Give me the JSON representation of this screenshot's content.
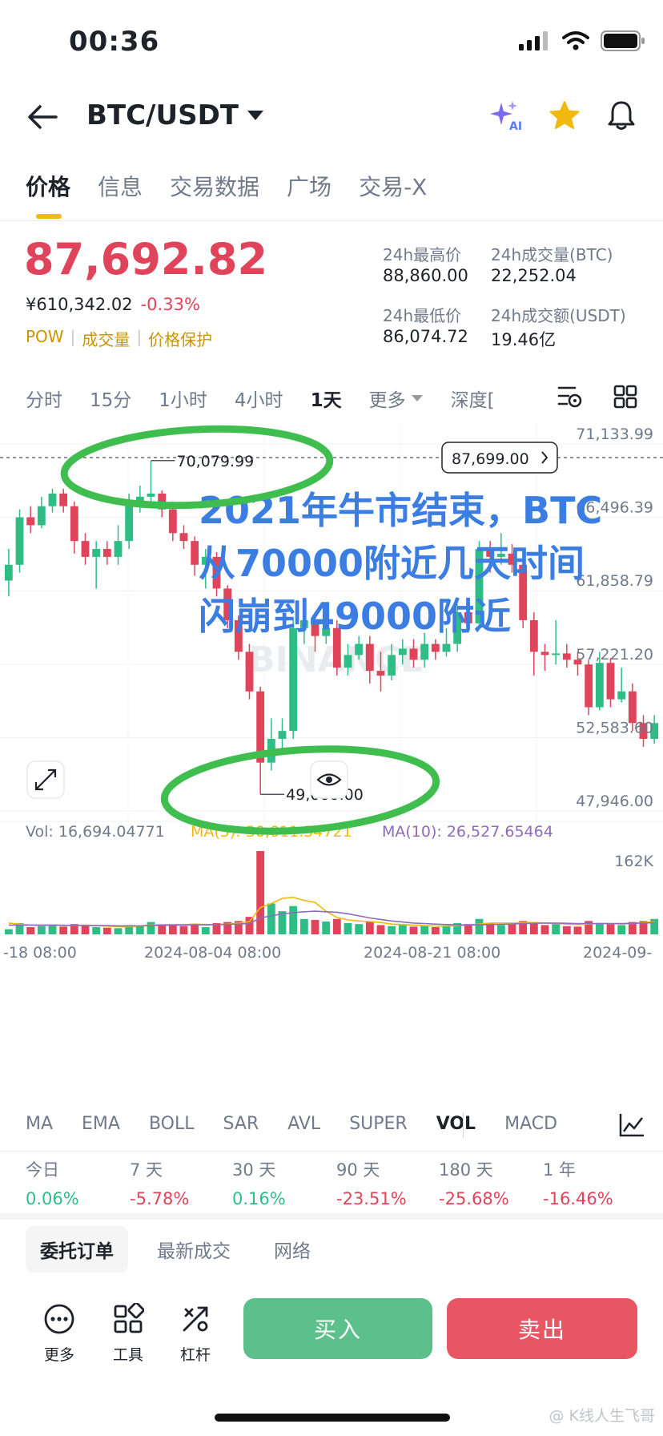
{
  "status": {
    "time": "00:36"
  },
  "header": {
    "pair": "BTC/USDT"
  },
  "tabs": [
    "价格",
    "信息",
    "交易数据",
    "广场",
    "交易-X"
  ],
  "price": {
    "last": "87,692.82",
    "cny": "¥610,342.02",
    "change": "-0.33%",
    "tags": [
      "POW",
      "成交量",
      "价格保护"
    ]
  },
  "stats": {
    "high_label": "24h最高价",
    "high_value": "88,860.00",
    "vol_btc_label": "24h成交量(BTC)",
    "vol_btc_value": "22,252.04",
    "low_label": "24h最低价",
    "low_value": "86,074.72",
    "vol_usdt_label": "24h成交额(USDT)",
    "vol_usdt_value": "19.46亿"
  },
  "intervals": [
    "分时",
    "15分",
    "1小时",
    "4小时",
    "1天",
    "更多",
    "深度["
  ],
  "chart": {
    "y_ticks": [
      "71,133.99",
      "66,496.39",
      "61,858.79",
      "57,221.20",
      "52,583.60",
      "47,946.00"
    ],
    "current_price_tag": "87,699.00",
    "high_label": "70,079.99",
    "low_label": "49,000.00",
    "vol_ma_label": "Vol: 16,694.04771",
    "ma5_label": "MA(5): 30,011.54721",
    "ma10_label": "MA(10): 26,527.65464",
    "vol_axis": "162K",
    "x_ticks": [
      "-18 08:00",
      "2024-08-04 08:00",
      "2024-08-21 08:00",
      "2024-09-"
    ],
    "watermark": "BINANCE",
    "annotation": [
      "2021年牛市结束，BTC",
      "从70000附近几天时间",
      "闪崩到49000附近"
    ],
    "colors": {
      "up": "#2ebd85",
      "down": "#e0445a",
      "ma5": "#f0b90b",
      "ma10": "#8e6bbd",
      "annotation": "#3b7de0",
      "circle": "#3fbe4f"
    }
  },
  "chart_data": {
    "type": "candlestick",
    "y_range": [
      47946,
      71133.99
    ],
    "candles": [
      {
        "o": 62500,
        "c": 63500,
        "h": 64500,
        "l": 61500
      },
      {
        "o": 63500,
        "c": 66500,
        "h": 67000,
        "l": 63000
      },
      {
        "o": 66500,
        "c": 66000,
        "h": 67200,
        "l": 65500
      },
      {
        "o": 66000,
        "c": 67200,
        "h": 67800,
        "l": 65800
      },
      {
        "o": 67200,
        "c": 68000,
        "h": 68300,
        "l": 66800
      },
      {
        "o": 68000,
        "c": 67200,
        "h": 68300,
        "l": 66800
      },
      {
        "o": 67200,
        "c": 65000,
        "h": 67500,
        "l": 64200
      },
      {
        "o": 65000,
        "c": 64000,
        "h": 65500,
        "l": 63500
      },
      {
        "o": 64000,
        "c": 64500,
        "h": 65000,
        "l": 62000
      },
      {
        "o": 64500,
        "c": 64000,
        "h": 65000,
        "l": 63500
      },
      {
        "o": 64000,
        "c": 65000,
        "h": 66000,
        "l": 63500
      },
      {
        "o": 65000,
        "c": 67500,
        "h": 68000,
        "l": 64500
      },
      {
        "o": 67500,
        "c": 67800,
        "h": 68500,
        "l": 66800
      },
      {
        "o": 67800,
        "c": 68000,
        "h": 70079.99,
        "l": 67500
      },
      {
        "o": 68000,
        "c": 67000,
        "h": 68200,
        "l": 66500
      },
      {
        "o": 67000,
        "c": 65500,
        "h": 67500,
        "l": 65000
      },
      {
        "o": 65500,
        "c": 65000,
        "h": 66000,
        "l": 64500
      },
      {
        "o": 65000,
        "c": 63500,
        "h": 65300,
        "l": 62800
      },
      {
        "o": 63500,
        "c": 64000,
        "h": 64500,
        "l": 62000
      },
      {
        "o": 64000,
        "c": 62000,
        "h": 64300,
        "l": 61500
      },
      {
        "o": 62000,
        "c": 60000,
        "h": 62200,
        "l": 59500
      },
      {
        "o": 60000,
        "c": 58000,
        "h": 60300,
        "l": 57500
      },
      {
        "o": 58000,
        "c": 55500,
        "h": 58500,
        "l": 55000
      },
      {
        "o": 55500,
        "c": 51000,
        "h": 55800,
        "l": 49000
      },
      {
        "o": 51000,
        "c": 52500,
        "h": 53800,
        "l": 50500
      },
      {
        "o": 52500,
        "c": 53000,
        "h": 53800,
        "l": 51500
      },
      {
        "o": 53000,
        "c": 59500,
        "h": 60000,
        "l": 52500
      },
      {
        "o": 59500,
        "c": 60000,
        "h": 60600,
        "l": 58500
      },
      {
        "o": 60000,
        "c": 59000,
        "h": 60500,
        "l": 58000
      },
      {
        "o": 59000,
        "c": 59500,
        "h": 61000,
        "l": 58500
      },
      {
        "o": 59500,
        "c": 57000,
        "h": 60000,
        "l": 56500
      },
      {
        "o": 57000,
        "c": 57800,
        "h": 58500,
        "l": 56500
      },
      {
        "o": 57800,
        "c": 58500,
        "h": 59000,
        "l": 57500
      },
      {
        "o": 58500,
        "c": 56800,
        "h": 59000,
        "l": 56000
      },
      {
        "o": 56800,
        "c": 56500,
        "h": 58000,
        "l": 55500
      },
      {
        "o": 56500,
        "c": 57800,
        "h": 58500,
        "l": 56200
      },
      {
        "o": 57800,
        "c": 58200,
        "h": 58800,
        "l": 57200
      },
      {
        "o": 58200,
        "c": 57500,
        "h": 58800,
        "l": 57000
      },
      {
        "o": 57500,
        "c": 58500,
        "h": 59200,
        "l": 57000
      },
      {
        "o": 58500,
        "c": 58000,
        "h": 58800,
        "l": 57500
      },
      {
        "o": 58000,
        "c": 58500,
        "h": 59500,
        "l": 57700
      },
      {
        "o": 58500,
        "c": 60500,
        "h": 61000,
        "l": 58000
      },
      {
        "o": 60500,
        "c": 59800,
        "h": 61000,
        "l": 59200
      },
      {
        "o": 59800,
        "c": 64500,
        "h": 65000,
        "l": 59500
      },
      {
        "o": 64500,
        "c": 64000,
        "h": 65000,
        "l": 63000
      },
      {
        "o": 64000,
        "c": 64200,
        "h": 65500,
        "l": 63500
      },
      {
        "o": 64200,
        "c": 63500,
        "h": 64800,
        "l": 63000
      },
      {
        "o": 63500,
        "c": 60000,
        "h": 63800,
        "l": 59500
      },
      {
        "o": 60000,
        "c": 58000,
        "h": 60500,
        "l": 56500
      },
      {
        "o": 58000,
        "c": 57800,
        "h": 58500,
        "l": 56800
      },
      {
        "o": 57800,
        "c": 57900,
        "h": 60000,
        "l": 57200
      },
      {
        "o": 57900,
        "c": 57500,
        "h": 58500,
        "l": 57000
      },
      {
        "o": 57500,
        "c": 57200,
        "h": 58000,
        "l": 56500
      },
      {
        "o": 57200,
        "c": 54500,
        "h": 57500,
        "l": 54000
      },
      {
        "o": 54500,
        "c": 57300,
        "h": 58000,
        "l": 54300
      },
      {
        "o": 57300,
        "c": 55000,
        "h": 57600,
        "l": 54500
      },
      {
        "o": 55000,
        "c": 55500,
        "h": 57000,
        "l": 54800
      },
      {
        "o": 55500,
        "c": 53500,
        "h": 56000,
        "l": 53000
      },
      {
        "o": 53500,
        "c": 52500,
        "h": 54000,
        "l": 52000
      },
      {
        "o": 52500,
        "c": 53500,
        "h": 54000,
        "l": 52200
      }
    ],
    "volume_max": 162000,
    "volumes": [
      10000,
      22000,
      14000,
      16000,
      18000,
      15000,
      20000,
      17000,
      14000,
      13000,
      12000,
      18000,
      16000,
      24000,
      20000,
      18000,
      16000,
      20000,
      14000,
      22000,
      24000,
      26000,
      34000,
      162000,
      60000,
      45000,
      55000,
      30000,
      28000,
      25000,
      30000,
      22000,
      20000,
      24000,
      18000,
      16000,
      18000,
      15000,
      17000,
      14000,
      16000,
      22000,
      20000,
      30000,
      22000,
      18000,
      20000,
      26000,
      24000,
      18000,
      20000,
      16000,
      15000,
      26000,
      22000,
      20000,
      18000,
      24000,
      26000,
      30000
    ],
    "ma5": [
      22000,
      20000,
      18000,
      17000,
      18000,
      18000,
      17000,
      18000,
      17000,
      16000,
      15000,
      15000,
      16000,
      18000,
      19000,
      19000,
      19000,
      20000,
      19000,
      19000,
      20000,
      22000,
      25000,
      52000,
      60000,
      70000,
      72000,
      66000,
      62000,
      45000,
      33000,
      28000,
      26000,
      25000,
      23000,
      20000,
      19000,
      18000,
      17000,
      16000,
      16000,
      17000,
      18000,
      20000,
      22000,
      22000,
      22000,
      23000,
      23000,
      22000,
      21000,
      20000,
      19000,
      20000,
      21000,
      21000,
      20000,
      21000,
      23000,
      24000
    ],
    "ma10": [
      18000,
      18000,
      18000,
      18000,
      18000,
      17500,
      17500,
      17000,
      17000,
      17000,
      16500,
      16500,
      16500,
      17000,
      17500,
      18000,
      18000,
      18500,
      18500,
      19000,
      19500,
      20000,
      21000,
      32000,
      36000,
      40000,
      42000,
      44000,
      45000,
      44000,
      43000,
      40000,
      36000,
      32000,
      29000,
      26000,
      24000,
      22000,
      21000,
      20000,
      19000,
      18500,
      18000,
      18500,
      19000,
      19500,
      20000,
      21000,
      21500,
      22000,
      22000,
      21500,
      21000,
      21000,
      21000,
      21000,
      21000,
      21500,
      22000,
      22500
    ]
  },
  "indicators": [
    "MA",
    "EMA",
    "BOLL",
    "SAR",
    "AVL",
    "SUPER",
    "VOL",
    "MACD"
  ],
  "performance": [
    {
      "label": "今日",
      "value": "0.06%",
      "dir": "pos"
    },
    {
      "label": "7 天",
      "value": "-5.78%",
      "dir": "neg"
    },
    {
      "label": "30 天",
      "value": "0.16%",
      "dir": "pos"
    },
    {
      "label": "90 天",
      "value": "-23.51%",
      "dir": "neg"
    },
    {
      "label": "180 天",
      "value": "-25.68%",
      "dir": "neg"
    },
    {
      "label": "1 年",
      "value": "-16.46%",
      "dir": "neg"
    }
  ],
  "order_tabs": [
    "委托订单",
    "最新成交",
    "网络"
  ],
  "bottom": {
    "more": "更多",
    "tools": "工具",
    "leverage": "杠杆",
    "buy": "买入",
    "sell": "卖出"
  },
  "watermark": "@ K线人生飞哥"
}
